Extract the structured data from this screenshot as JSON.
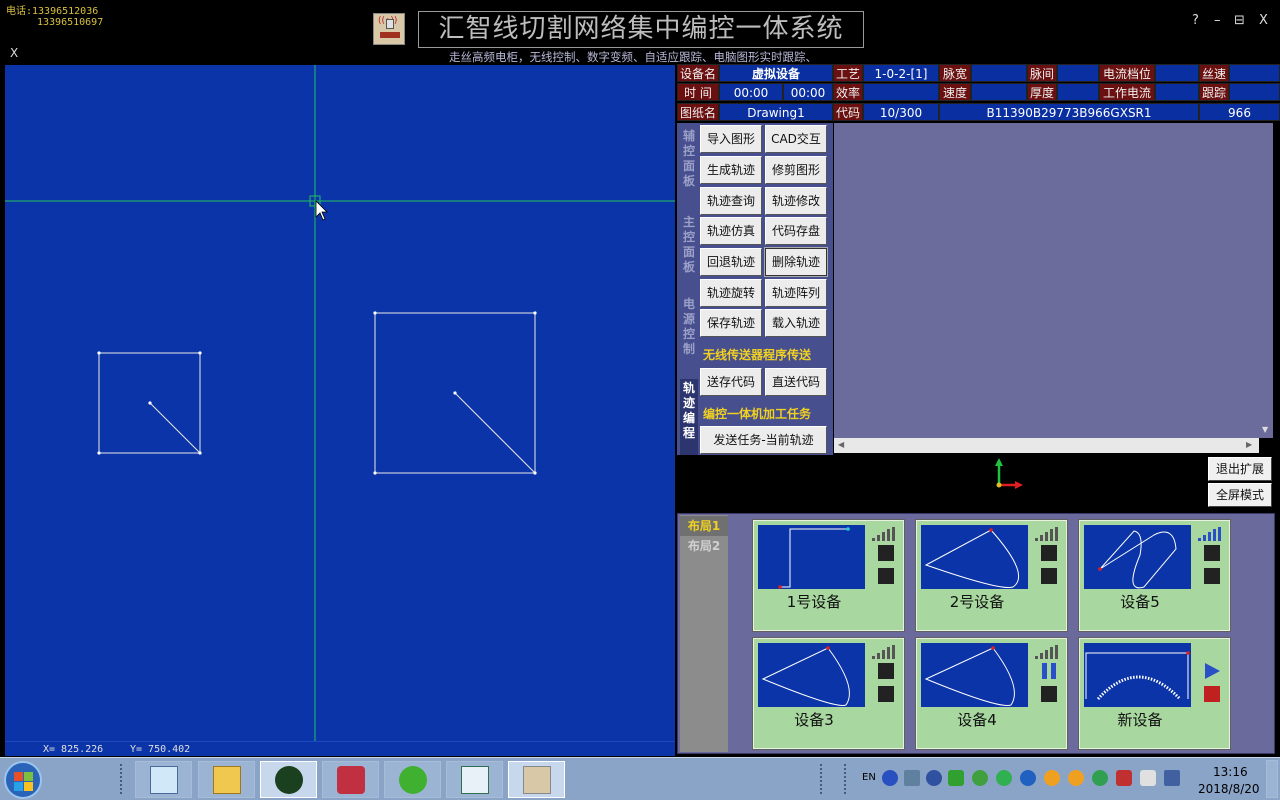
{
  "titlebar": {
    "phone1": "电话:13396512036",
    "phone2": "13396510697",
    "app_x": "X",
    "title": "汇智线切割网络集中编控一体系统",
    "subtitle": "走丝高频电柜，无线控制、数字变频、自适应跟踪、电脑图形实时跟踪、",
    "help": "?",
    "minimize": "–",
    "maximize": "⊟",
    "close": "X"
  },
  "canvas": {
    "coord_x": "X= 825.226",
    "coord_y": "Y= 750.402"
  },
  "info_table": {
    "r1": {
      "l1": "设备名",
      "v1": "虚拟设备",
      "l2": "工艺",
      "v2": "1-0-2-[1]",
      "l3": "脉宽",
      "l4": "脉间",
      "l5": "电流档位",
      "l6": "丝速"
    },
    "r2": {
      "l1": "时  间",
      "v1a": "00:00",
      "v1b": "00:00",
      "l2": "效率",
      "l3": "速度",
      "l4": "厚度",
      "l5": "工作电流",
      "l6": "跟踪"
    },
    "r3": {
      "l1": "图纸名",
      "v1": "Drawing1",
      "l2": "代码",
      "v2": "10/300",
      "v3": "B11390B29773B966GXSR1",
      "v4": "966"
    }
  },
  "panel": {
    "tabs": {
      "aux": "辅控面板",
      "main": "主控面板",
      "power": "电源控制",
      "track": "轨迹编程"
    },
    "buttons": {
      "import_shape": "导入图形",
      "cad_interact": "CAD交互",
      "gen_track": "生成轨迹",
      "trim_shape": "修剪图形",
      "query_track": "轨迹查询",
      "modify_track": "轨迹修改",
      "simulate_track": "轨迹仿真",
      "save_code": "代码存盘",
      "retreat_track": "回退轨迹",
      "delete_track": "删除轨迹",
      "rotate_track": "轨迹旋转",
      "array_track": "轨迹阵列",
      "save_track": "保存轨迹",
      "load_track": "载入轨迹",
      "send_store_code": "送存代码",
      "direct_code": "直送代码",
      "send_task": "发送任务-当前轨迹"
    },
    "sections": {
      "wireless": "无线传送器程序传送",
      "task": "编控一体机加工任务"
    }
  },
  "side_buttons": {
    "exit_expand": "退出扩展",
    "fullscreen": "全屏模式"
  },
  "layout": {
    "tab1": "布局1",
    "tab2": "布局2",
    "devices": [
      "1号设备",
      "2号设备",
      "设备5",
      "设备3",
      "设备4",
      "新设备"
    ]
  },
  "taskbar": {
    "lang": "EN",
    "time": "13:16",
    "date": "2018/8/20"
  },
  "colors": {
    "canvas_bg": "#0b34a8",
    "label_bg": "#6a1010",
    "card_bg": "#a8d8a0",
    "section_text": "#f0d020"
  }
}
